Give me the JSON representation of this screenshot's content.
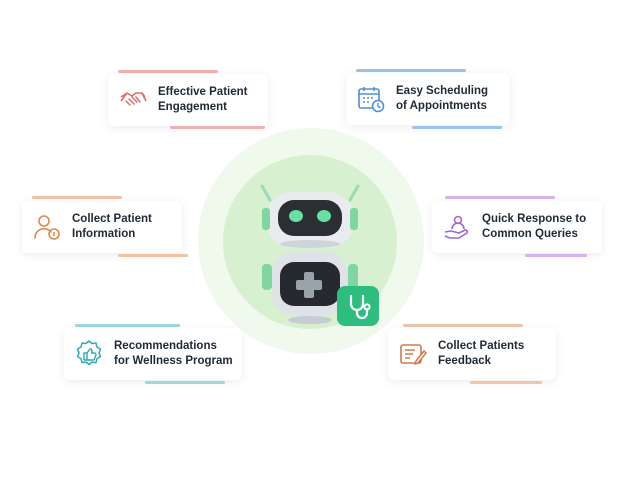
{
  "features": [
    {
      "id": "engagement",
      "lines": [
        "Effective Patient",
        "Engagement"
      ],
      "icon": "handshake-icon",
      "color": "#e06b6b"
    },
    {
      "id": "scheduling",
      "lines": [
        "Easy Scheduling",
        "of Appointments"
      ],
      "icon": "calendar-clock-icon",
      "color": "#4a8fd8"
    },
    {
      "id": "collect-info",
      "lines": [
        "Collect Patient",
        "Information"
      ],
      "icon": "user-info-icon",
      "color": "#e3884a"
    },
    {
      "id": "quick-response",
      "lines": [
        "Quick Response to",
        "Common Queries"
      ],
      "icon": "hand-user-icon",
      "color": "#a266d4"
    },
    {
      "id": "wellness",
      "lines": [
        "Recommendations",
        "for Wellness Program"
      ],
      "icon": "thumbs-up-badge-icon",
      "color": "#2eaab0"
    },
    {
      "id": "feedback",
      "lines": [
        "Collect Patients",
        "Feedback"
      ],
      "icon": "feedback-form-icon",
      "color": "#d27a4a"
    }
  ],
  "center": {
    "illustration": "medical-robot-illustration",
    "badge_icon": "stethoscope-icon",
    "badge_color": "#2dbd7e"
  }
}
